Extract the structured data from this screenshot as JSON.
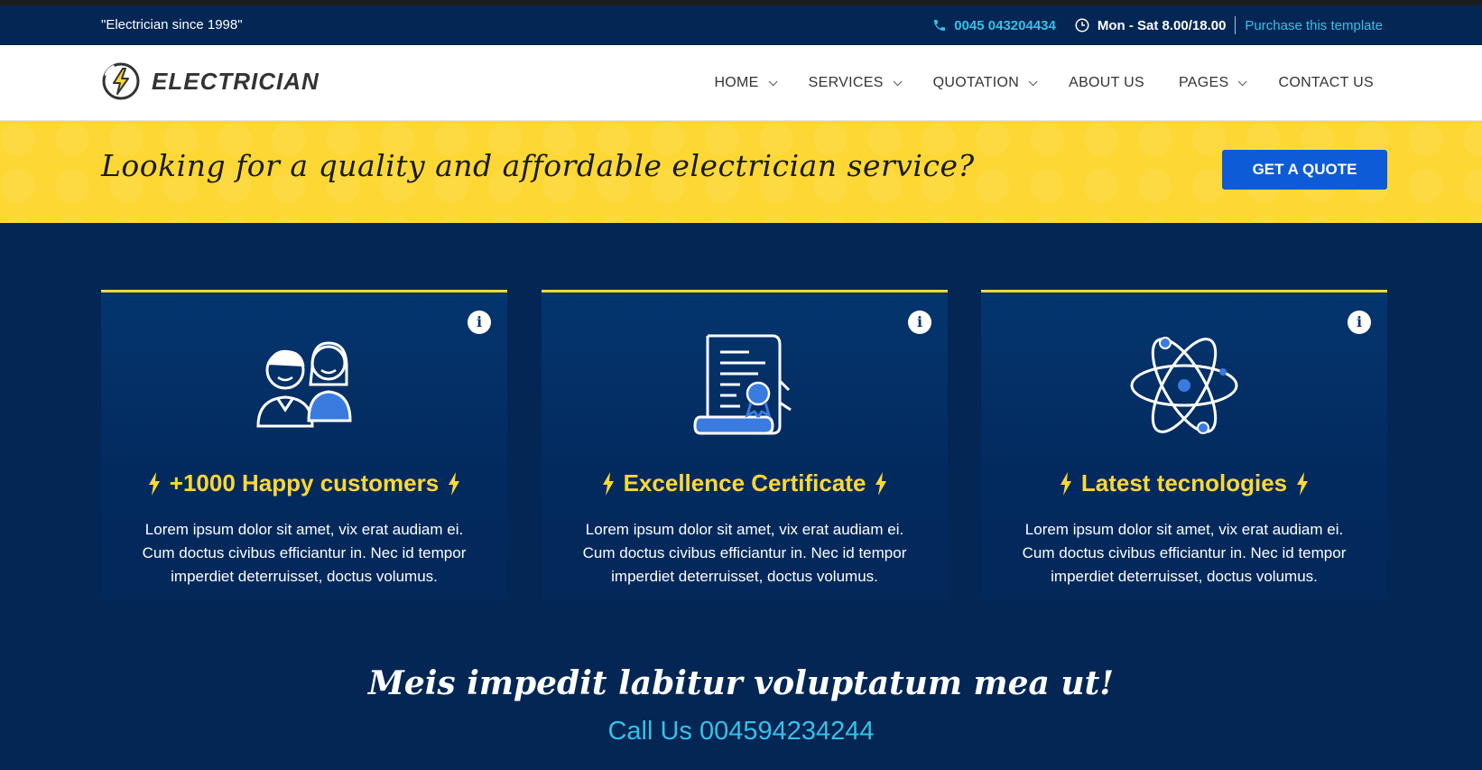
{
  "topbar": {
    "tagline": "\"Electrician since 1998\"",
    "phone": "0045 043204434",
    "hours": "Mon - Sat 8.00/18.00",
    "purchase_label": "Purchase this template"
  },
  "header": {
    "logo_text": "ELECTRICIAN",
    "nav": [
      {
        "label": "HOME"
      },
      {
        "label": "SERVICES"
      },
      {
        "label": "QUOTATION"
      },
      {
        "label": "ABOUT US"
      },
      {
        "label": "PAGES"
      },
      {
        "label": "CONTACT US"
      }
    ]
  },
  "banner": {
    "headline": "Looking for a quality and affordable electrician service?",
    "cta_label": "GET A QUOTE"
  },
  "features": [
    {
      "title": "+1000 Happy customers",
      "description": "Lorem ipsum dolor sit amet, vix erat audiam ei. Cum doctus civibus efficiantur in. Nec id tempor imperdiet deterruisset, doctus volumus.",
      "icon": "customers-icon"
    },
    {
      "title": "Excellence Certificate",
      "description": "Lorem ipsum dolor sit amet, vix erat audiam ei. Cum doctus civibus efficiantur in. Nec id tempor imperdiet deterruisset, doctus volumus.",
      "icon": "certificate-icon"
    },
    {
      "title": "Latest tecnologies",
      "description": "Lorem ipsum dolor sit amet, vix erat audiam ei. Cum doctus civibus efficiantur in. Nec id tempor imperdiet deterruisset, doctus volumus.",
      "icon": "atom-icon"
    }
  ],
  "cta": {
    "title": "Meis impedit labitur voluptatum mea ut!",
    "phone": "Call Us 004594234244"
  },
  "colors": {
    "navy": "#032654",
    "yellow": "#fdd835",
    "cyan": "#35c1e8",
    "button_blue": "#0d5bd6"
  }
}
